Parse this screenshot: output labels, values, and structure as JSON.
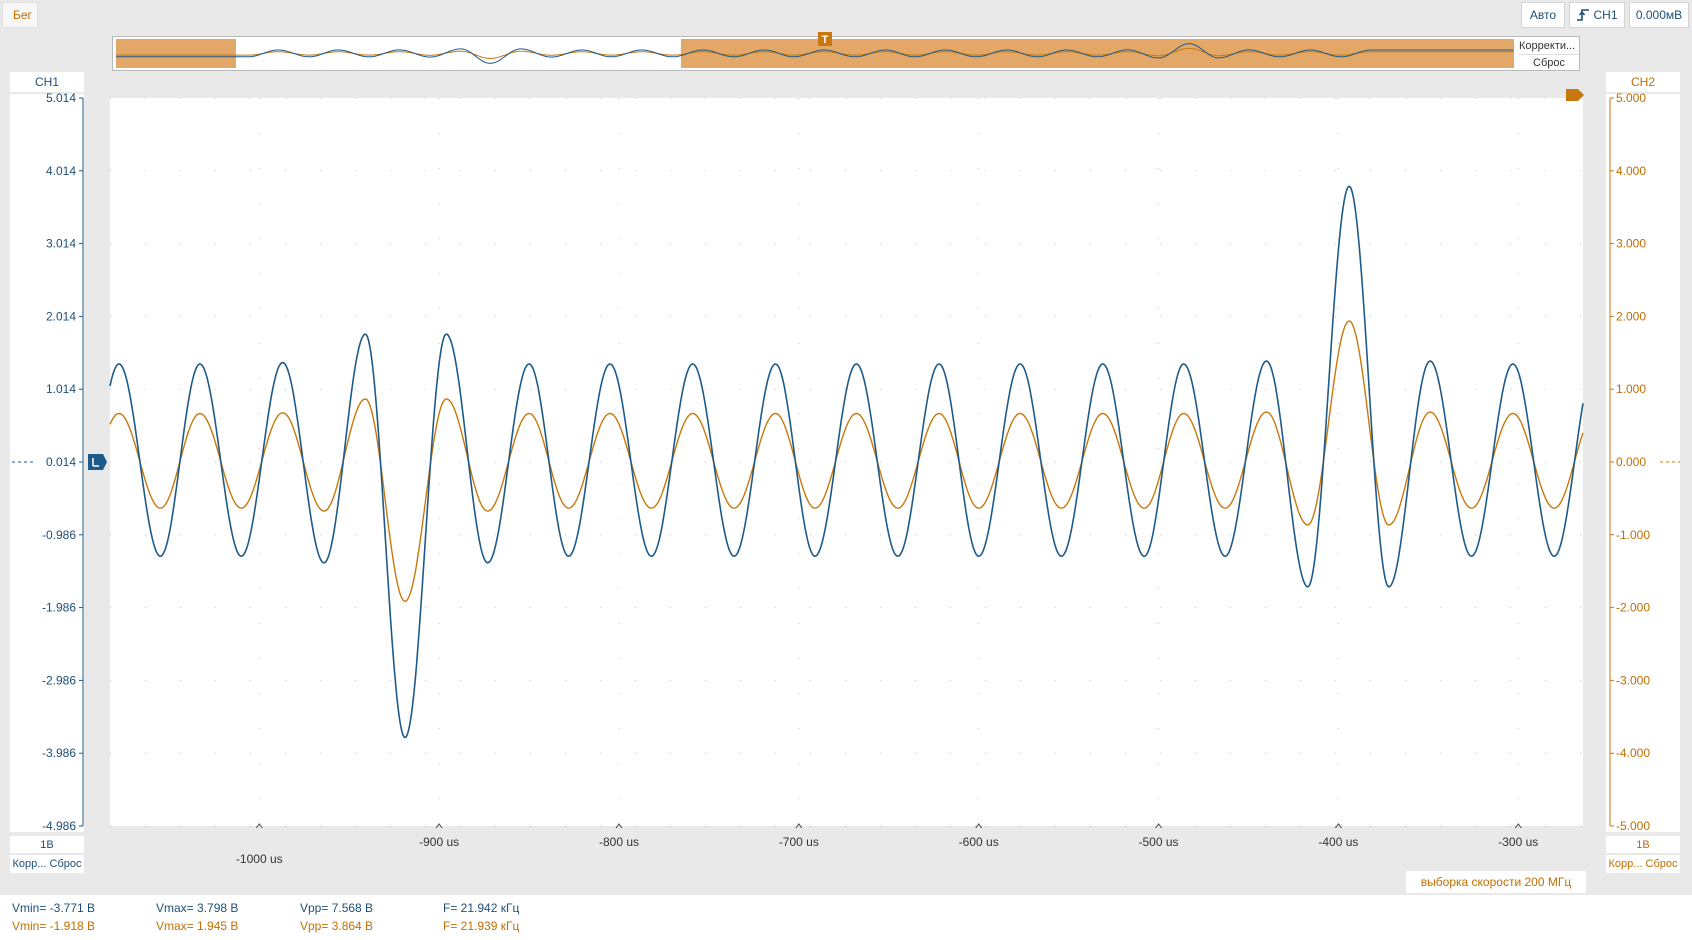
{
  "toolbar": {
    "run_label": "Бег",
    "mode_label": "Авто",
    "trigger_source": "CH1",
    "trigger_level": "0.000мВ"
  },
  "overview": {
    "ctrl_corr": "Корректи...",
    "ctrl_reset": "Сброс"
  },
  "channels": {
    "ch1": {
      "label": "CH1",
      "scale": "1В",
      "corr": "Корр... Сброс",
      "color": "#1e5b8a",
      "marker_value": "0.014"
    },
    "ch2": {
      "label": "CH2",
      "scale": "1В",
      "corr": "Корр... Сброс",
      "color": "#c8780d"
    }
  },
  "sample_rate": "выборка скорости 200 МГц",
  "measurements": {
    "ch1": {
      "vmin": "Vmin= -3.771 В",
      "vmax": "Vmax= 3.798 В",
      "vpp": "Vpp= 7.568 В",
      "freq": "F= 21.942 кГц"
    },
    "ch2": {
      "vmin": "Vmin= -1.918 В",
      "vmax": "Vmax= 1.945 В",
      "vpp": "Vpp= 3.864 В",
      "freq": "F= 21.939 кГц"
    }
  },
  "chart_data": {
    "type": "line",
    "x_unit": "us",
    "xlim": [
      -1083,
      -264
    ],
    "x_ticks": [
      {
        "value": -1000,
        "label": "-1000 us",
        "row": 2
      },
      {
        "value": -900,
        "label": "-900 us",
        "row": 1
      },
      {
        "value": -800,
        "label": "-800 us",
        "row": 1
      },
      {
        "value": -700,
        "label": "-700 us",
        "row": 1
      },
      {
        "value": -600,
        "label": "-600 us",
        "row": 1
      },
      {
        "value": -500,
        "label": "-500 us",
        "row": 1
      },
      {
        "value": -400,
        "label": "-400 us",
        "row": 1
      },
      {
        "value": -300,
        "label": "-300 us",
        "row": 1
      }
    ],
    "y_left": {
      "ylim": [
        -4.986,
        5.014
      ],
      "ticks": [
        "5.014",
        "4.014",
        "3.014",
        "2.014",
        "1.014",
        "0.014",
        "-0.986",
        "-1.986",
        "-2.986",
        "-3.986",
        "-4.986"
      ]
    },
    "y_right": {
      "ylim": [
        -5,
        5
      ],
      "ticks": [
        "5.000",
        "4.000",
        "3.000",
        "2.000",
        "1.000",
        "0.000",
        "-1.000",
        "-2.000",
        "-3.000",
        "-4.000",
        "-5.000"
      ]
    },
    "grid": true,
    "series": [
      {
        "name": "CH1",
        "color": "#1e5b8a",
        "period_us": 45.6,
        "x": [
          -1078,
          -1055,
          -1033,
          -1010,
          -987,
          -964,
          -941,
          -919,
          -896,
          -873,
          -850,
          -828,
          -805,
          -782,
          -759,
          -736,
          -713,
          -691,
          -668,
          -645,
          -622,
          -600,
          -577,
          -554,
          -531,
          -508,
          -486,
          -463,
          -440,
          -417,
          -394,
          -372,
          -349,
          -326,
          -303,
          -280
        ],
        "y": [
          1.36,
          -1.28,
          1.36,
          -1.28,
          1.38,
          -1.37,
          1.77,
          -3.77,
          1.77,
          -1.37,
          1.36,
          -1.28,
          1.36,
          -1.28,
          1.36,
          -1.28,
          1.36,
          -1.28,
          1.36,
          -1.28,
          1.36,
          -1.28,
          1.36,
          -1.28,
          1.36,
          -1.28,
          1.36,
          -1.28,
          1.4,
          -1.7,
          3.8,
          -1.7,
          1.4,
          -1.28,
          1.36,
          -1.28
        ]
      },
      {
        "name": "CH2",
        "color": "#c8780d",
        "period_us": 45.6,
        "x": [
          -1078,
          -1055,
          -1033,
          -1010,
          -987,
          -964,
          -941,
          -919,
          -896,
          -873,
          -850,
          -828,
          -805,
          -782,
          -759,
          -736,
          -713,
          -691,
          -668,
          -645,
          -622,
          -600,
          -577,
          -554,
          -531,
          -508,
          -486,
          -463,
          -440,
          -417,
          -394,
          -372,
          -349,
          -326,
          -303,
          -280
        ],
        "y": [
          0.68,
          -0.62,
          0.68,
          -0.62,
          0.69,
          -0.66,
          0.88,
          -1.9,
          0.88,
          -0.66,
          0.68,
          -0.62,
          0.68,
          -0.62,
          0.68,
          -0.62,
          0.68,
          -0.62,
          0.68,
          -0.62,
          0.68,
          -0.62,
          0.68,
          -0.62,
          0.68,
          -0.62,
          0.68,
          -0.62,
          0.7,
          -0.85,
          1.95,
          -0.85,
          0.7,
          -0.62,
          0.68,
          -0.62
        ]
      }
    ]
  }
}
